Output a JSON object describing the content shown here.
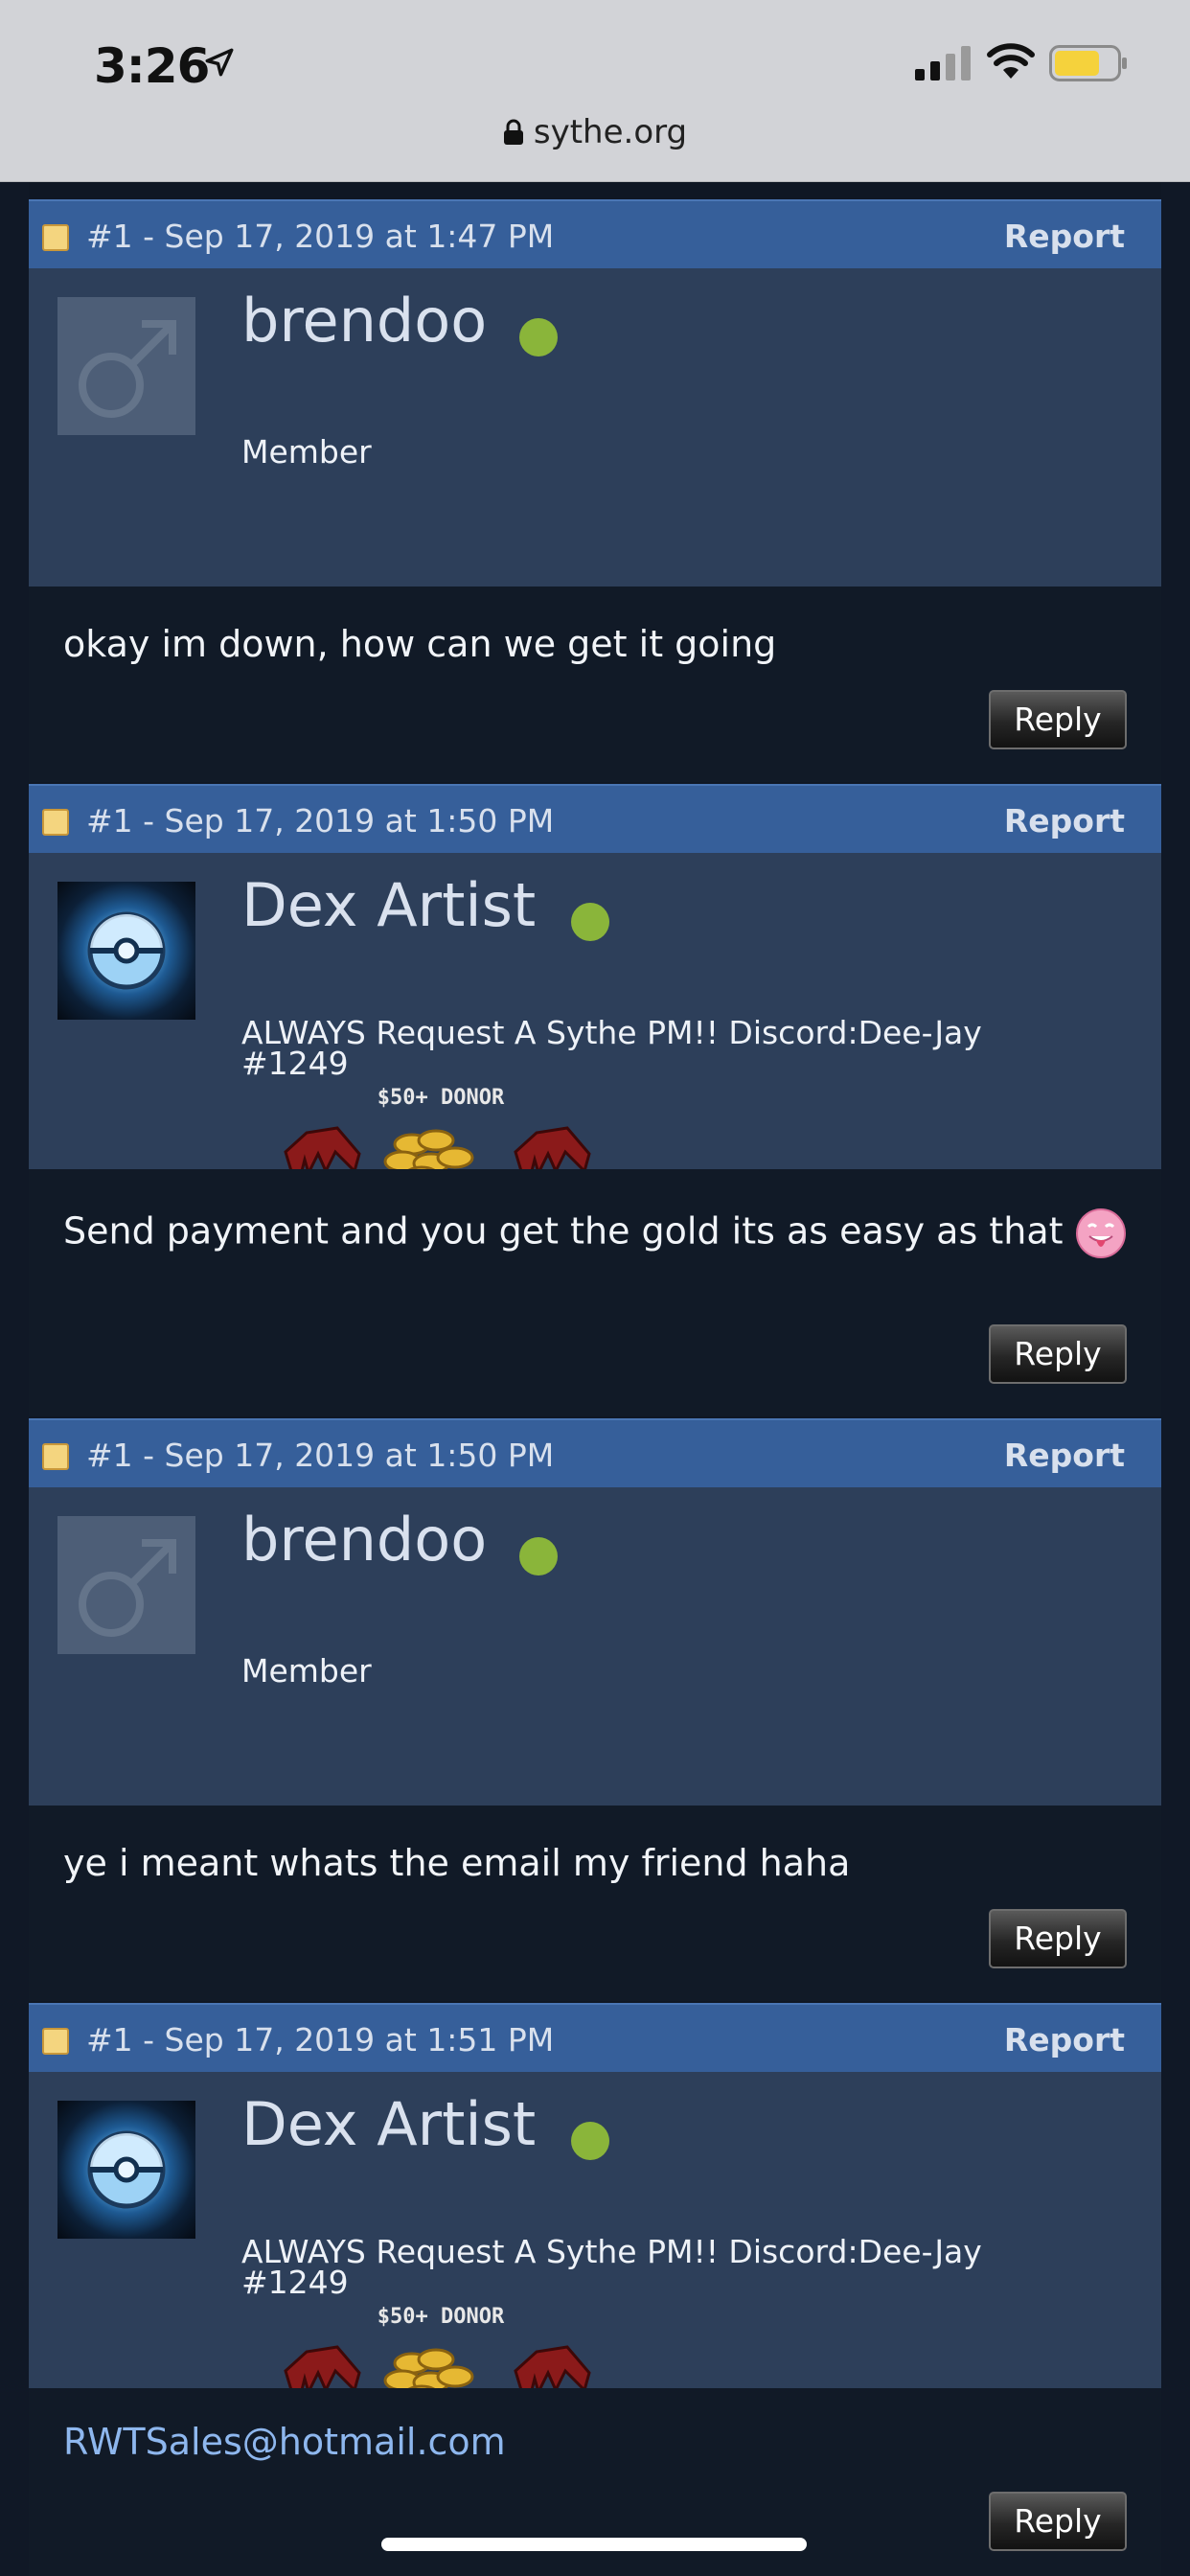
{
  "status_bar": {
    "time": "3:26",
    "url": "sythe.org"
  },
  "posts": [
    {
      "meta": "#1 - Sep 17, 2019 at 1:47 PM",
      "report": "Report",
      "username": "brendoo",
      "title": "Member",
      "message": "okay im down, how can we get it going",
      "reply": "Reply"
    },
    {
      "meta": "#1 - Sep 17, 2019 at 1:50 PM",
      "report": "Report",
      "username": "Dex Artist",
      "title_line1": "ALWAYS Request A Sythe PM!! Discord:Dee-Jay",
      "title_line2": "#1249",
      "badge_text": "$50+ DONOR",
      "message": "Send payment and you get the gold its as easy as that",
      "reply": "Reply"
    },
    {
      "meta": "#1 - Sep 17, 2019 at 1:50 PM",
      "report": "Report",
      "username": "brendoo",
      "title": "Member",
      "message": "ye i meant whats the email my friend haha",
      "reply": "Reply"
    },
    {
      "meta": "#1 - Sep 17, 2019 at 1:51 PM",
      "report": "Report",
      "username": "Dex Artist",
      "title_line1": "ALWAYS Request A Sythe PM!! Discord:Dee-Jay",
      "title_line2": "#1249",
      "badge_text": "$50+ DONOR",
      "message": "RWTSales@hotmail.com",
      "reply": "Reply"
    }
  ],
  "colors": {
    "header": "#365f9a",
    "user_panel": "#2d3f5a",
    "post_body": "#111a27",
    "online": "#8ab53a",
    "link": "#8eb7ee"
  }
}
